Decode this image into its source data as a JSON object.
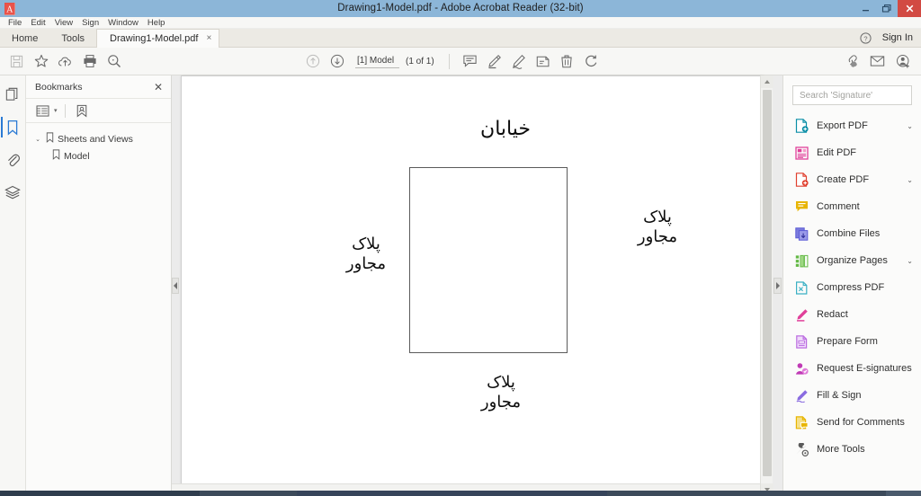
{
  "window": {
    "title": "Drawing1-Model.pdf - Adobe Acrobat Reader (32-bit)",
    "app_icon": "acrobat-icon",
    "minimize_label": "–",
    "restore_label": "❐",
    "close_label": "✕"
  },
  "menubar": {
    "items": [
      {
        "label": "File"
      },
      {
        "label": "Edit"
      },
      {
        "label": "View"
      },
      {
        "label": "Sign"
      },
      {
        "label": "Window"
      },
      {
        "label": "Help"
      }
    ]
  },
  "tabs": {
    "home": "Home",
    "tools": "Tools",
    "document": "Drawing1-Model.pdf",
    "document_close": "×",
    "help_icon": "question-mark-circle-icon",
    "sign_in": "Sign In"
  },
  "toolbar": {
    "left_icons": [
      {
        "name": "save-icon",
        "disabled": true
      },
      {
        "name": "star-icon",
        "disabled": false
      },
      {
        "name": "cloud-upload-icon",
        "disabled": false
      },
      {
        "name": "print-icon",
        "disabled": false
      },
      {
        "name": "zoom-search-icon",
        "disabled": false
      }
    ],
    "previous_page_icon": "arrow-up-circle-icon",
    "next_page_icon": "arrow-down-circle-icon",
    "page_label": "[1] Model",
    "page_count": "(1 of 1)",
    "center_icons": [
      {
        "name": "comment-icon"
      },
      {
        "name": "highlight-pen-icon"
      },
      {
        "name": "draw-signature-icon"
      },
      {
        "name": "stamp-icon"
      },
      {
        "name": "delete-trash-icon"
      },
      {
        "name": "rotate-icon"
      }
    ],
    "right_icons": [
      {
        "name": "share-link-icon"
      },
      {
        "name": "email-envelope-icon"
      },
      {
        "name": "add-person-icon"
      }
    ]
  },
  "rail": {
    "items": [
      {
        "name": "page-thumbnails-icon",
        "active": false
      },
      {
        "name": "bookmarks-icon",
        "active": true
      },
      {
        "name": "attachments-paperclip-icon",
        "active": false
      },
      {
        "name": "layers-icon",
        "active": false
      }
    ]
  },
  "bookmarks": {
    "title": "Bookmarks",
    "close_label": "✕",
    "options_icon": "bookmark-options-icon",
    "options_caret": "▾",
    "new_bookmark_icon": "new-bookmark-icon",
    "tree": [
      {
        "label": "Sheets and Views",
        "twisty": "⌄",
        "level": 0
      },
      {
        "label": "Model",
        "twisty": "",
        "level": 1
      }
    ]
  },
  "viewer": {
    "collapse_left_icon": "collapse-left-arrow-icon",
    "collapse_right_icon": "collapse-right-arrow-icon",
    "scroll_up_icon": "scroll-up-arrow-icon",
    "scroll_down_icon": "scroll-down-arrow-icon"
  },
  "document": {
    "texts": [
      {
        "id": "street",
        "content": "خیابان",
        "position": "top"
      },
      {
        "id": "plaque-left",
        "content": "پلاک\nمجاور",
        "position": "left"
      },
      {
        "id": "plaque-right",
        "content": "پلاک\nمجاور",
        "position": "right"
      },
      {
        "id": "plaque-bottom",
        "content": "پلاک\nمجاور",
        "position": "bottom"
      }
    ],
    "shape": "rectangle-outline"
  },
  "right_panel": {
    "search_placeholder": "Search 'Signature'",
    "search_value": "",
    "items": [
      {
        "label": "Export PDF",
        "icon": "export-pdf-icon",
        "chevron": "⌄",
        "color": "#0a8ea6"
      },
      {
        "label": "Edit PDF",
        "icon": "edit-pdf-icon",
        "chevron": "",
        "color": "#e0409a"
      },
      {
        "label": "Create PDF",
        "icon": "create-pdf-icon",
        "chevron": "⌄",
        "color": "#e0402f"
      },
      {
        "label": "Comment",
        "icon": "comment-icon",
        "chevron": "",
        "color": "#e8b500"
      },
      {
        "label": "Combine Files",
        "icon": "combine-files-icon",
        "chevron": "",
        "color": "#5b5bd6"
      },
      {
        "label": "Organize Pages",
        "icon": "organize-pages-icon",
        "chevron": "⌄",
        "color": "#63b944"
      },
      {
        "label": "Compress PDF",
        "icon": "compress-pdf-icon",
        "chevron": "",
        "color": "#3ab0c4"
      },
      {
        "label": "Redact",
        "icon": "redact-icon",
        "chevron": "",
        "color": "#e0409a"
      },
      {
        "label": "Prepare Form",
        "icon": "prepare-form-icon",
        "chevron": "",
        "color": "#bb6ce0"
      },
      {
        "label": "Request E-signatures",
        "icon": "request-esignatures-icon",
        "chevron": "",
        "color": "#c03ab5"
      },
      {
        "label": "Fill & Sign",
        "icon": "fill-sign-icon",
        "chevron": "",
        "color": "#8a6ce0"
      },
      {
        "label": "Send for Comments",
        "icon": "send-for-comments-icon",
        "chevron": "",
        "color": "#e8b500"
      },
      {
        "label": "More Tools",
        "icon": "more-tools-icon",
        "chevron": "",
        "color": "#5a5a5a"
      }
    ]
  },
  "colors": {
    "titlebar": "#8fb8d9",
    "close_button": "#d24a43",
    "accent_blue": "#2a7ad4",
    "panel_bg": "#fbfbfa",
    "viewer_bg": "#ebebeb",
    "taskbar": "#3c4a5a"
  }
}
